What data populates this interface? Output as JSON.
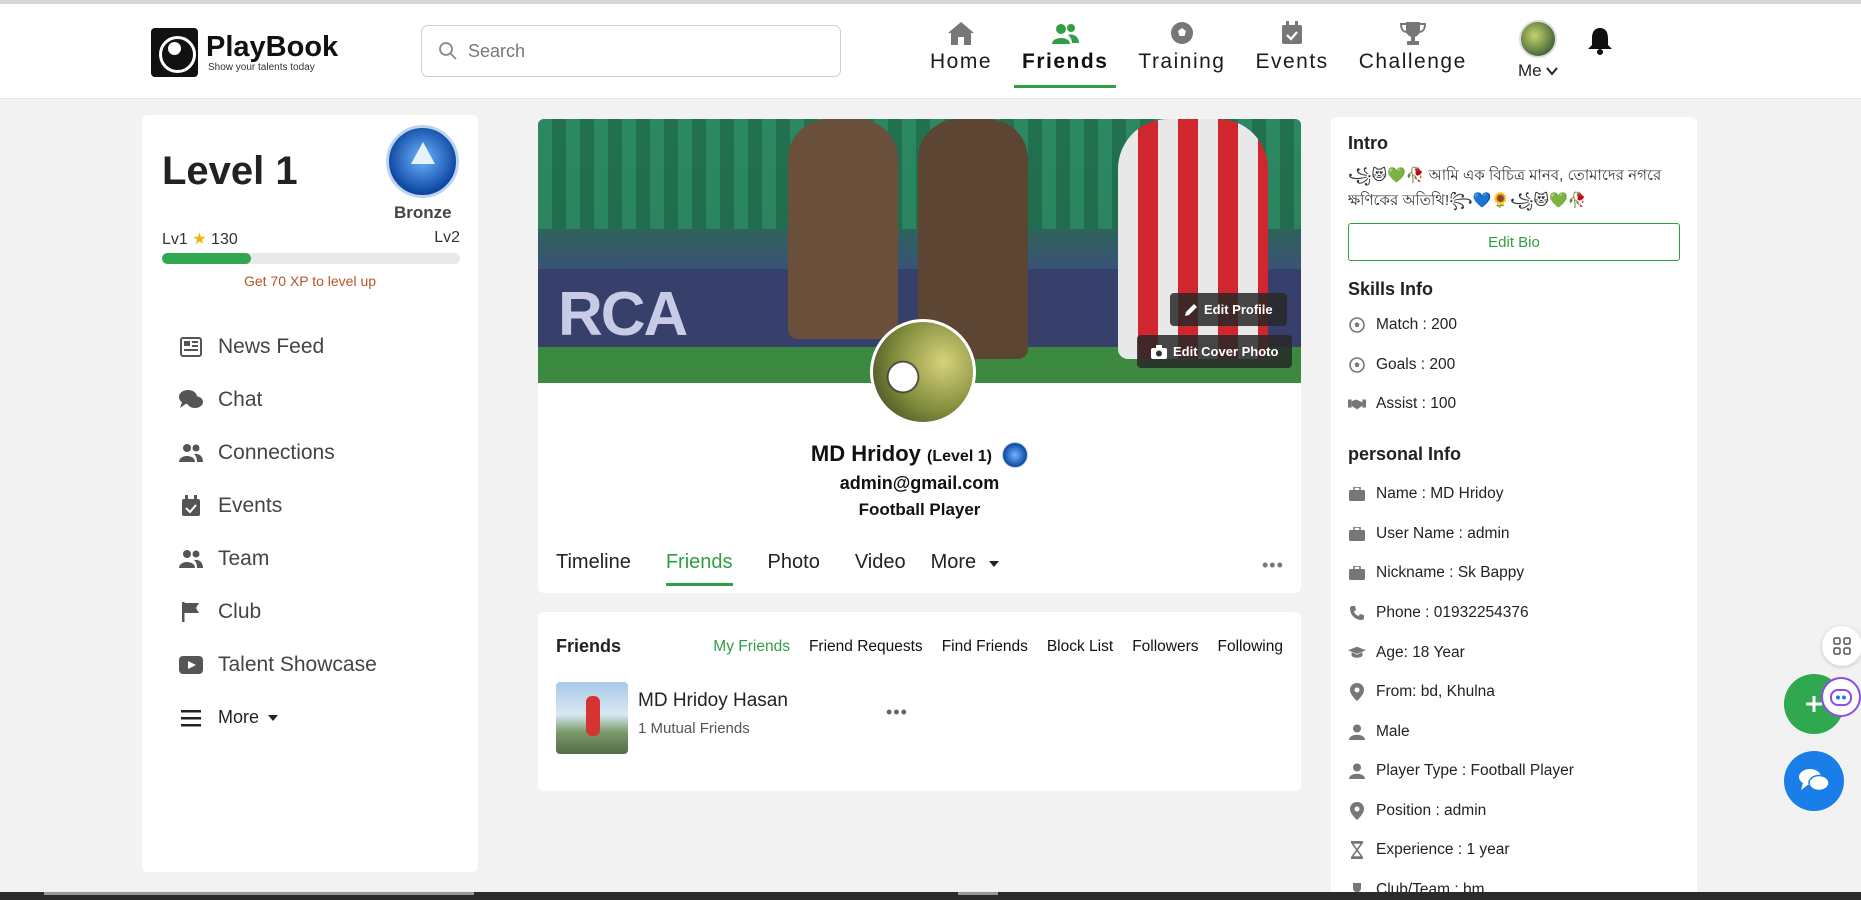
{
  "app": {
    "name": "PlayBook",
    "tagline": "Show your talents today"
  },
  "search": {
    "placeholder": "Search"
  },
  "nav": {
    "items": [
      {
        "label": "Home",
        "icon": "home-icon"
      },
      {
        "label": "Friends",
        "icon": "friends-icon",
        "active": true
      },
      {
        "label": "Training",
        "icon": "soccer-ball-icon"
      },
      {
        "label": "Events",
        "icon": "calendar-check-icon"
      },
      {
        "label": "Challenge",
        "icon": "trophy-icon"
      }
    ],
    "me_label": "Me",
    "accent": "#2f9e44"
  },
  "level": {
    "title": "Level 1",
    "badge": "Bronze",
    "current": "Lv1",
    "points": "130",
    "next": "Lv2",
    "progress": 0.3,
    "hint": "Get 70 XP to level up"
  },
  "menu": {
    "items": [
      {
        "label": "News Feed",
        "icon": "newspaper-icon"
      },
      {
        "label": "Chat",
        "icon": "chat-icon"
      },
      {
        "label": "Connections",
        "icon": "users-icon"
      },
      {
        "label": "Events",
        "icon": "calendar-check-icon"
      },
      {
        "label": "Team",
        "icon": "users-icon"
      },
      {
        "label": "Club",
        "icon": "flag-icon"
      },
      {
        "label": "Talent Showcase",
        "icon": "video-icon"
      },
      {
        "label": "More",
        "icon": "menu-icon"
      }
    ]
  },
  "profile": {
    "edit_profile": "Edit Profile",
    "edit_cover": "Edit Cover Photo",
    "cover_text": "RCA",
    "name": "MD Hridoy",
    "level": "(Level 1)",
    "email": "admin@gmail.com",
    "role": "Football Player",
    "tabs": [
      "Timeline",
      "Friends",
      "Photo",
      "Video",
      "More"
    ]
  },
  "friends": {
    "title": "Friends",
    "links": [
      "My Friends",
      "Friend Requests",
      "Find Friends",
      "Block List",
      "Followers",
      "Following"
    ],
    "list": [
      {
        "name": "MD Hridoy Hasan",
        "mutual": "1 Mutual Friends"
      }
    ]
  },
  "intro": {
    "title": "Intro",
    "bio_line1": "꧁😻💚🥀 আমি এক বিচিত্র মানব, তোমাদের নগরে",
    "bio_line2": "ক্ষণিকের অতিথি!꧂💙🌻꧁😻💚🥀",
    "edit_bio": "Edit Bio"
  },
  "skills": {
    "title": "Skills Info",
    "items": [
      "Match : 200",
      "Goals : 200",
      "Assist : 100"
    ]
  },
  "personal": {
    "title": "personal Info",
    "items": [
      "Name : MD Hridoy",
      "User Name : admin",
      "Nickname : Sk Bappy",
      "Phone : 01932254376",
      "Age: 18 Year",
      "From: bd, Khulna",
      "Male",
      "Player Type : Football Player",
      "Position : admin",
      "Experience : 1 year",
      "Club/Team : bm"
    ]
  }
}
